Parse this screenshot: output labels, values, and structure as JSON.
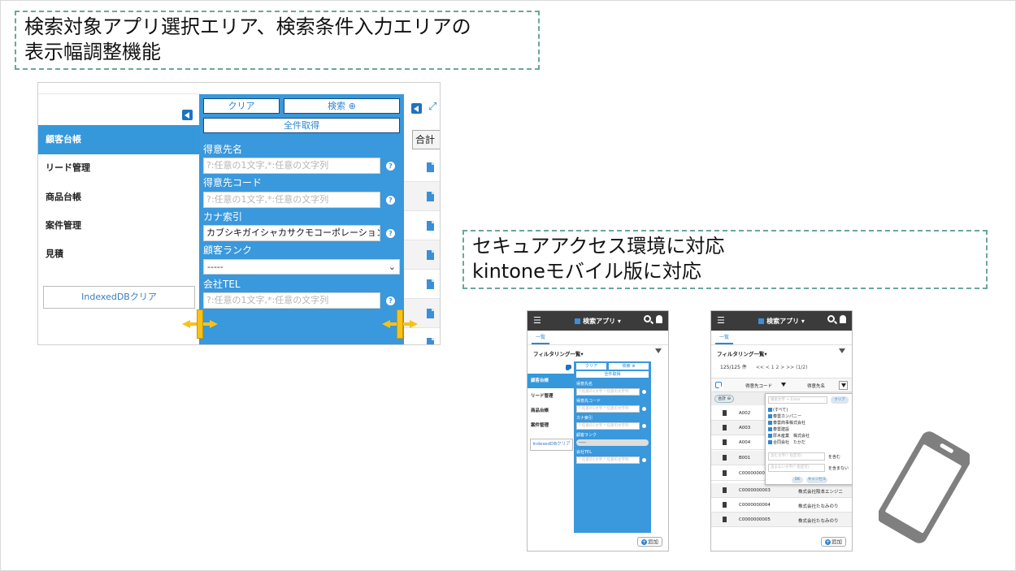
{
  "callouts": {
    "top": {
      "line1": "検索対象アプリ選択エリア、検索条件入力エリアの",
      "line2": "表示幅調整機能"
    },
    "right": {
      "line1": "セキュアアクセス環境に対応",
      "line2": "kintoneモバイル版に対応"
    }
  },
  "desktop": {
    "sidebar": {
      "items": [
        {
          "label": "顧客台帳",
          "active": true
        },
        {
          "label": "リード管理",
          "active": false
        },
        {
          "label": "商品台帳",
          "active": false
        },
        {
          "label": "案件管理",
          "active": false
        },
        {
          "label": "見積",
          "active": false
        }
      ],
      "indexeddb_button": "IndexedDBクリア"
    },
    "search_panel": {
      "clear_button": "クリア",
      "search_button": "検索 ⊕",
      "fetch_all_button": "全件取得",
      "fields": [
        {
          "label": "得意先名",
          "value": "",
          "placeholder": "?:任意の1文字,*:任意の文字列"
        },
        {
          "label": "得意先コード",
          "value": "",
          "placeholder": "?:任意の1文字,*:任意の文字列"
        },
        {
          "label": "カナ索引",
          "value": "カブシキガイシャカサクモコーポレーション",
          "placeholder": ""
        },
        {
          "label": "顧客ランク",
          "select_value": "-----"
        },
        {
          "label": "会社TEL",
          "value": "",
          "placeholder": "?:任意の1文字,*:任意の文字列"
        }
      ]
    },
    "right_column": {
      "sum_label": "合計"
    }
  },
  "mobile1": {
    "header_title": "検索アプリ ▾",
    "tab": "一覧",
    "filter_label": "フィルタリング一覧▾",
    "sidebar_items": [
      "顧客台帳",
      "リード管理",
      "商品台帳",
      "案件管理"
    ],
    "indexeddb_button": "IndexedDBクリア",
    "clear_button": "クリア",
    "search_button": "検索 ⊕",
    "fetch_all_button": "全件取得",
    "labels": [
      "得意先名",
      "得意先コード",
      "カナ索引",
      "顧客ランク",
      "会社TEL"
    ],
    "placeholder": "?:任意の1文字,*:任意の文字列",
    "select_value": "-----",
    "add_button": "追加"
  },
  "mobile2": {
    "header_title": "検索アプリ ▾",
    "tab": "一覧",
    "filter_label": "フィルタリング一覧▾",
    "count": "125/125 件",
    "pager": "<< < 1 2 > >> (1/2)",
    "col_code": "得意先コード",
    "col_name": "得意先名",
    "sum_label": "合計 ⊖",
    "rows": [
      {
        "code": "A002",
        "name": ""
      },
      {
        "code": "A003",
        "name": ""
      },
      {
        "code": "A004",
        "name": ""
      },
      {
        "code": "B001",
        "name": ""
      },
      {
        "code": "C000000000",
        "name": ""
      },
      {
        "code": "C0000000003",
        "name": "株式会社阪本エンジニ"
      },
      {
        "code": "C0000000004",
        "name": "株式会社たなみのり"
      },
      {
        "code": "C0000000005",
        "name": "株式会社たなみのり"
      }
    ],
    "popup": {
      "search_placeholder": "検索文字 ⇒ Enter",
      "clear": "クリア",
      "checks": [
        "(すべて)",
        "泰雲カンパニー",
        "泰雲商事株式会社",
        "泰雲建設",
        "厚木産業　株式会社",
        "合同会社　たかだ"
      ],
      "contains_placeholder": "含む文字(* 指定可)",
      "not_contains_placeholder": "含まない文字(* 指定可)",
      "contains_label": "を含む",
      "not_contains_label": "を含まない",
      "ok": "OK",
      "cancel": "キャンセル"
    },
    "add_button": "追加"
  }
}
